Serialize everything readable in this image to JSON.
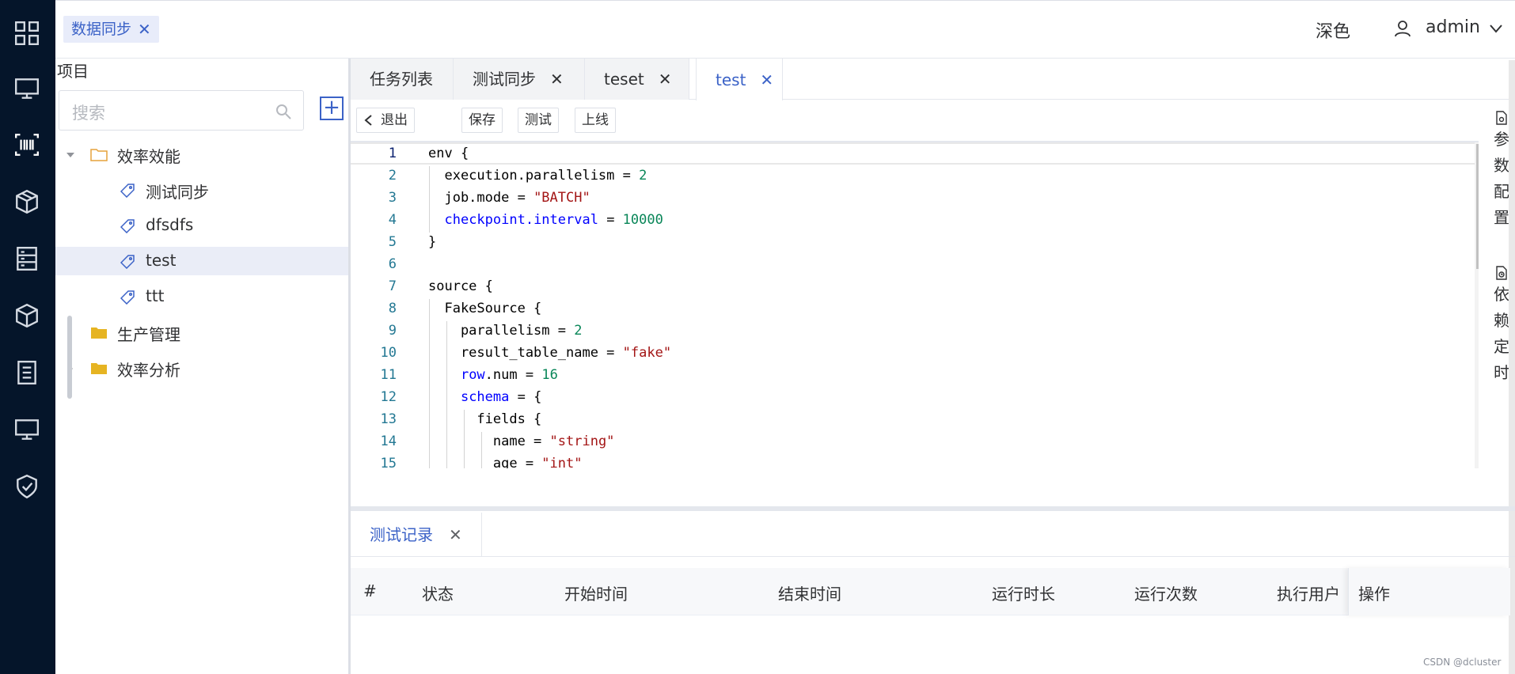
{
  "rail": {
    "icons": [
      "grid-icon",
      "monitor-icon",
      "barcode-icon",
      "cube-icon",
      "server-icon",
      "box-icon",
      "document-list-icon",
      "desktop-icon",
      "shield-check-icon"
    ]
  },
  "topbar": {
    "breadcrumb_tag": "数据同步",
    "theme_label": "深色",
    "user_name": "admin"
  },
  "sidebar": {
    "title": "项目",
    "search_placeholder": "搜索",
    "tree": [
      {
        "label": "效率效能",
        "type": "folder",
        "expanded": true
      },
      {
        "label": "测试同步",
        "type": "task"
      },
      {
        "label": "dfsdfs",
        "type": "task"
      },
      {
        "label": "test",
        "type": "task",
        "selected": true
      },
      {
        "label": "ttt",
        "type": "task"
      },
      {
        "label": "生产管理",
        "type": "folder"
      },
      {
        "label": "效率分析",
        "type": "folder"
      }
    ]
  },
  "tabs": [
    {
      "label": "任务列表",
      "closable": false
    },
    {
      "label": "测试同步",
      "closable": true
    },
    {
      "label": "teset",
      "closable": true
    },
    {
      "label": "test",
      "closable": true,
      "active": true
    }
  ],
  "toolbar": {
    "exit_label": "退出",
    "save_label": "保存",
    "test_label": "测试",
    "online_label": "上线"
  },
  "editor": {
    "lines": [
      {
        "n": "1",
        "text": "env {"
      },
      {
        "n": "2",
        "text": "  execution.parallelism = 2"
      },
      {
        "n": "3",
        "text": "  job.mode = \"BATCH\""
      },
      {
        "n": "4",
        "text": "  checkpoint.interval = 10000"
      },
      {
        "n": "5",
        "text": "}"
      },
      {
        "n": "6",
        "text": ""
      },
      {
        "n": "7",
        "text": "source {"
      },
      {
        "n": "8",
        "text": "  FakeSource {"
      },
      {
        "n": "9",
        "text": "    parallelism = 2"
      },
      {
        "n": "10",
        "text": "    result_table_name = \"fake\""
      },
      {
        "n": "11",
        "text": "    row.num = 16"
      },
      {
        "n": "12",
        "text": "    schema = {"
      },
      {
        "n": "13",
        "text": "      fields {"
      },
      {
        "n": "14",
        "text": "        name = \"string\""
      },
      {
        "n": "15",
        "text": "        age = \"int\""
      }
    ]
  },
  "right_panel": {
    "param_config": "参数配置",
    "dependency_schedule": "依赖定时"
  },
  "bottom": {
    "tab_label": "测试记录",
    "columns": [
      "#",
      "状态",
      "开始时间",
      "结束时间",
      "运行时长",
      "运行次数",
      "执行用户"
    ],
    "op_column": "操作"
  },
  "watermark": "CSDN @dcluster"
}
